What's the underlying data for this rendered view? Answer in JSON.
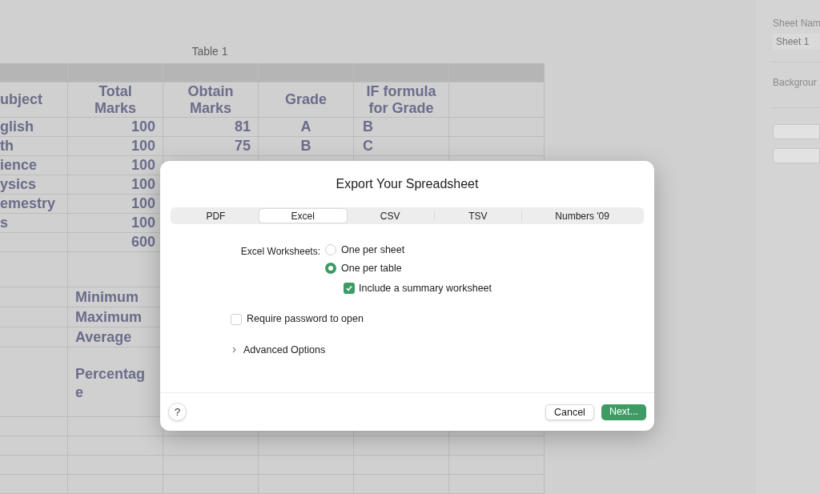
{
  "table": {
    "title": "Table 1",
    "columns": [
      "ubject",
      "Total Marks",
      "Obtain Marks",
      "Grade",
      "IF formula for Grade"
    ],
    "rows": [
      {
        "cells": [
          "glish",
          "100",
          "81",
          "A",
          "B"
        ]
      },
      {
        "cells": [
          "th",
          "100",
          "75",
          "B",
          "C"
        ]
      },
      {
        "cells": [
          "ience",
          "100"
        ]
      },
      {
        "cells": [
          "ysics",
          "100"
        ]
      },
      {
        "cells": [
          "emestry",
          "100"
        ]
      },
      {
        "cells": [
          "s",
          "100"
        ]
      },
      {
        "cells": [
          null,
          "600"
        ]
      }
    ],
    "summary_rows": [
      {
        "label": "Minimum"
      },
      {
        "label": "Maximum"
      },
      {
        "label": "Average"
      },
      {
        "label": "Percentage",
        "kind": "tall"
      }
    ]
  },
  "sidebar": {
    "sheet_name_label": "Sheet Nam",
    "sheet_name_value": "Sheet 1",
    "background_label": "Backgrour"
  },
  "dialog": {
    "title": "Export Your Spreadsheet",
    "tabs": [
      {
        "label": "PDF",
        "selected": false
      },
      {
        "label": "Excel",
        "selected": true
      },
      {
        "label": "CSV",
        "selected": false
      },
      {
        "label": "TSV",
        "selected": false
      },
      {
        "label": "Numbers '09",
        "selected": false
      }
    ],
    "worksheets_label": "Excel Worksheets:",
    "worksheet_options": [
      {
        "label": "One per sheet",
        "selected": false
      },
      {
        "label": "One per table",
        "selected": true
      }
    ],
    "summary_option": {
      "label": "Include a summary worksheet",
      "checked": true
    },
    "password_option": {
      "label": "Require password to open",
      "checked": false
    },
    "advanced": {
      "label": "Advanced Options",
      "expanded": false
    },
    "help_button": "?",
    "buttons": [
      {
        "label": "Cancel",
        "kind": "secondary"
      },
      {
        "label": "Next...",
        "kind": "primary"
      }
    ]
  }
}
